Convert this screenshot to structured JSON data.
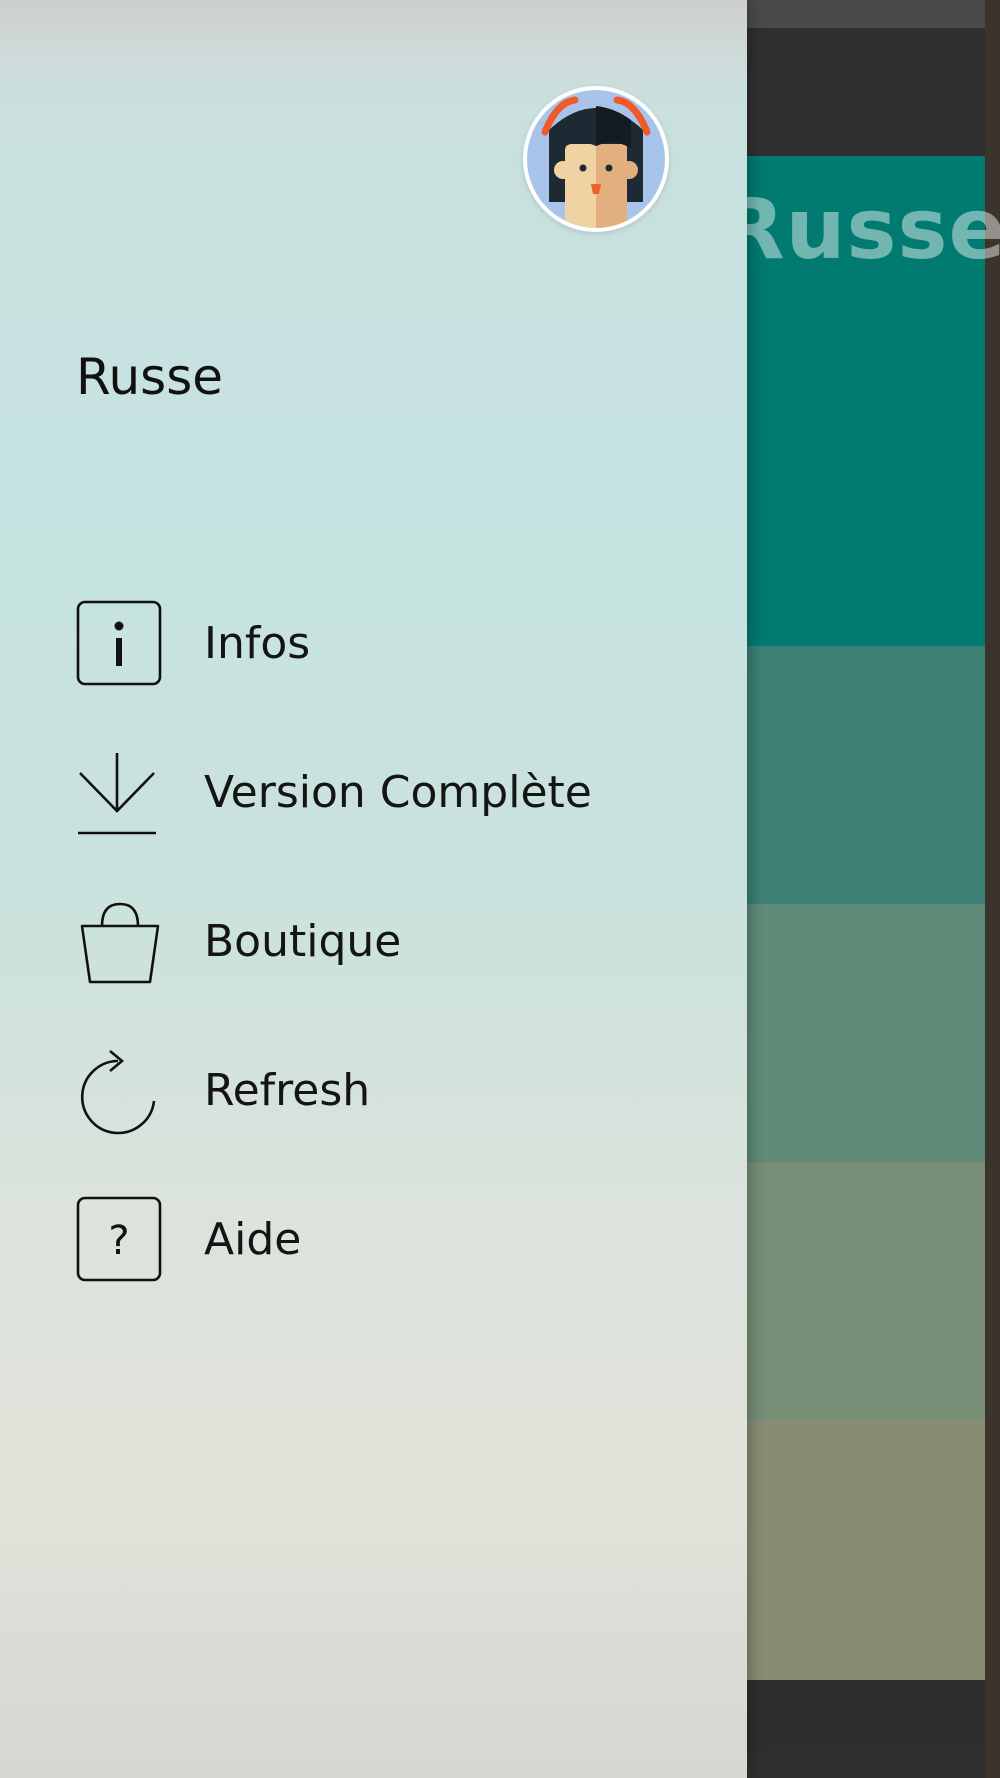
{
  "app": {
    "background_title": "Russe",
    "colors": {
      "hero": "#017a71",
      "band_1": "#3c8075",
      "band_2": "#5f8a77",
      "band_3": "#778d76",
      "band_4": "#878c73"
    }
  },
  "drawer": {
    "avatar_icon": "girl-avatar-icon",
    "user_name": "Russe",
    "menu": [
      {
        "id": "infos",
        "label": "Infos",
        "icon": "info-icon"
      },
      {
        "id": "version-complete",
        "label": "Version Complète",
        "icon": "download-icon"
      },
      {
        "id": "boutique",
        "label": "Boutique",
        "icon": "shopping-bag-icon"
      },
      {
        "id": "refresh",
        "label": "Refresh",
        "icon": "refresh-icon"
      },
      {
        "id": "aide",
        "label": "Aide",
        "icon": "help-icon"
      }
    ]
  }
}
